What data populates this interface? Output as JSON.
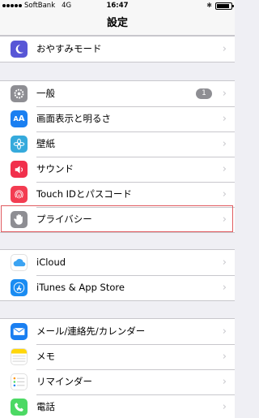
{
  "status_bar": {
    "carrier": "SoftBank",
    "network": "4G",
    "time": "16:47",
    "battery_level": 0.9
  },
  "nav": {
    "title": "設定"
  },
  "colors": {
    "highlight": "#e05a5f",
    "dnd": "#5856d6",
    "general": "#8e8e93",
    "display": "#1a7ff1",
    "wallpaper": "#35aadc",
    "sounds": "#f1304c",
    "touchid": "#f33c51",
    "privacy": "#8e8e93",
    "icloud": "#ffffff",
    "appstore": "#1a8cf2",
    "contacts": "#1a7ff1",
    "notes": "#ffd60a",
    "reminders": "#ffffff",
    "phone": "#4cd964"
  },
  "groups": [
    {
      "items": [
        {
          "id": "dnd",
          "label": "おやすみモード",
          "icon": "moon-icon"
        }
      ]
    },
    {
      "items": [
        {
          "id": "general",
          "label": "一般",
          "icon": "gear-icon",
          "badge": "1"
        },
        {
          "id": "display",
          "label": "画面表示と明るさ",
          "icon": "text-size-icon"
        },
        {
          "id": "wallpaper",
          "label": "壁紙",
          "icon": "flower-icon"
        },
        {
          "id": "sounds",
          "label": "サウンド",
          "icon": "speaker-icon"
        },
        {
          "id": "touchid",
          "label": "Touch IDとパスコード",
          "icon": "fingerprint-icon"
        },
        {
          "id": "privacy",
          "label": "プライバシー",
          "icon": "hand-icon"
        }
      ]
    },
    {
      "items": [
        {
          "id": "icloud",
          "label": "iCloud",
          "icon": "cloud-icon"
        },
        {
          "id": "appstore",
          "label": "iTunes & App Store",
          "icon": "app-store-icon"
        }
      ]
    },
    {
      "items": [
        {
          "id": "contacts",
          "label": "メール/連絡先/カレンダー",
          "icon": "mail-icon"
        },
        {
          "id": "notes",
          "label": "メモ",
          "icon": "notes-icon"
        },
        {
          "id": "reminders",
          "label": "リマインダー",
          "icon": "list-icon"
        },
        {
          "id": "phone",
          "label": "電話",
          "icon": "phone-icon"
        }
      ]
    }
  ]
}
